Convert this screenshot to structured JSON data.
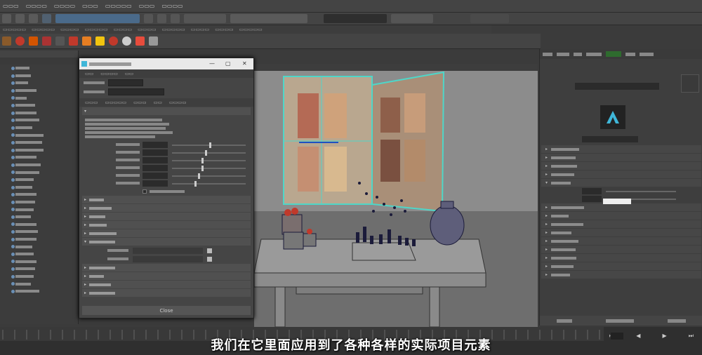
{
  "subtitle": "我们在它里面应用到了各种各样的实际项目元素",
  "dialog": {
    "close_button": "Close",
    "sections_closed": [
      "",
      "",
      "",
      "",
      "",
      "",
      "",
      "",
      ""
    ]
  },
  "viewport": {
    "frame_label": "",
    "coord_label": ""
  },
  "colors": {
    "selection_wire": "#4fd6c8",
    "wire": "#1b1b3a",
    "apple": "#c0392b",
    "attr_swatch": "#eeeeee",
    "logo_bg": "#222222",
    "logo_fg": "#3fb6d8"
  },
  "icons": {
    "arnold_logo": "arnold-a-icon",
    "outliner_item": "transform-node-icon"
  }
}
